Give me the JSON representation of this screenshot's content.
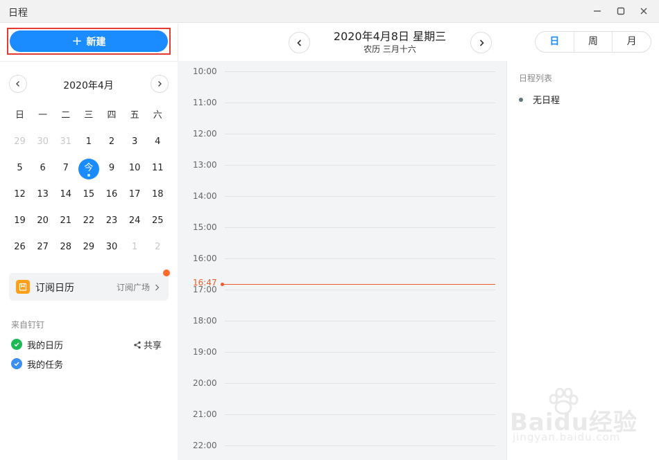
{
  "window": {
    "title": "日程"
  },
  "sidebar": {
    "new_button_label": "新建",
    "mini_calendar": {
      "month_label": "2020年4月",
      "weekdays": [
        "日",
        "一",
        "二",
        "三",
        "四",
        "五",
        "六"
      ],
      "weeks": [
        [
          {
            "d": "29",
            "dim": true
          },
          {
            "d": "30",
            "dim": true
          },
          {
            "d": "31",
            "dim": true
          },
          {
            "d": "1"
          },
          {
            "d": "2"
          },
          {
            "d": "3"
          },
          {
            "d": "4"
          }
        ],
        [
          {
            "d": "5"
          },
          {
            "d": "6"
          },
          {
            "d": "7"
          },
          {
            "d": "今",
            "today": true
          },
          {
            "d": "9"
          },
          {
            "d": "10"
          },
          {
            "d": "11"
          }
        ],
        [
          {
            "d": "12"
          },
          {
            "d": "13"
          },
          {
            "d": "14"
          },
          {
            "d": "15"
          },
          {
            "d": "16"
          },
          {
            "d": "17"
          },
          {
            "d": "18"
          }
        ],
        [
          {
            "d": "19"
          },
          {
            "d": "20"
          },
          {
            "d": "21"
          },
          {
            "d": "22"
          },
          {
            "d": "23"
          },
          {
            "d": "24"
          },
          {
            "d": "25"
          }
        ],
        [
          {
            "d": "26"
          },
          {
            "d": "27"
          },
          {
            "d": "28"
          },
          {
            "d": "29"
          },
          {
            "d": "30"
          },
          {
            "d": "1",
            "dim": true
          },
          {
            "d": "2",
            "dim": true
          }
        ]
      ]
    },
    "subscribe": {
      "label": "订阅日历",
      "link": "订阅广场"
    },
    "source_label": "来自钉钉",
    "calendars": [
      {
        "name": "我的日历",
        "color": "#1db954"
      },
      {
        "name": "我的任务",
        "color": "#3b8ff0"
      }
    ],
    "share_label": "共享"
  },
  "header": {
    "date_title": "2020年4月8日 星期三",
    "lunar": "农历 三月十六",
    "views": [
      "日",
      "周",
      "月"
    ],
    "active_view": "日"
  },
  "timeline": {
    "hours": [
      "10:00",
      "11:00",
      "12:00",
      "13:00",
      "14:00",
      "15:00",
      "16:00",
      "17:00",
      "18:00",
      "19:00",
      "20:00",
      "21:00",
      "22:00"
    ],
    "now_label": "16:47"
  },
  "agenda": {
    "title": "日程列表",
    "empty_text": "无日程"
  },
  "watermark": {
    "brand": "Baidu经验",
    "url": "jingyan.baidu.com"
  },
  "colors": {
    "accent": "#1a8cff",
    "now": "#f05a28",
    "highlight_border": "#e53935"
  }
}
